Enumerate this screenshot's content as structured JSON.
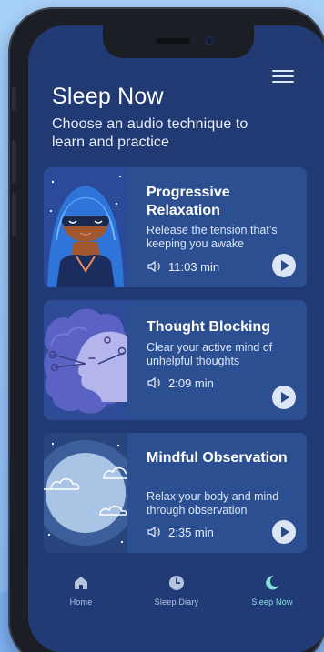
{
  "header": {
    "title": "Sleep Now",
    "subtitle": "Choose an audio technique to learn and practice",
    "menu_icon": "menu-icon"
  },
  "cards": [
    {
      "title": "Progressive Relaxation",
      "description": "Release the tension that’s keeping you awake",
      "duration": "11:03 min",
      "duration_icon": "speaker-icon",
      "action_icon": "play-icon"
    },
    {
      "title": "Thought Blocking",
      "description": "Clear your active mind of unhelpful thoughts",
      "duration": "2:09 min",
      "duration_icon": "speaker-icon",
      "action_icon": "play-icon"
    },
    {
      "title": "Mindful Observation",
      "description": "Relax your body and mind through observation",
      "duration": "2:35 min",
      "duration_icon": "speaker-icon",
      "action_icon": "play-icon"
    }
  ],
  "tabs": [
    {
      "label": "Home",
      "icon": "home-icon",
      "active": false
    },
    {
      "label": "Sleep Diary",
      "icon": "clock-icon",
      "active": false
    },
    {
      "label": "Sleep Now",
      "icon": "crescent-moon-icon",
      "active": true
    }
  ],
  "colors": {
    "screen_background": "#213a74",
    "card_background": "#2c4f92",
    "active_tab": "#8be0dd",
    "inactive_tab": "#b7c4de",
    "page_background": "#8fc2f6"
  }
}
